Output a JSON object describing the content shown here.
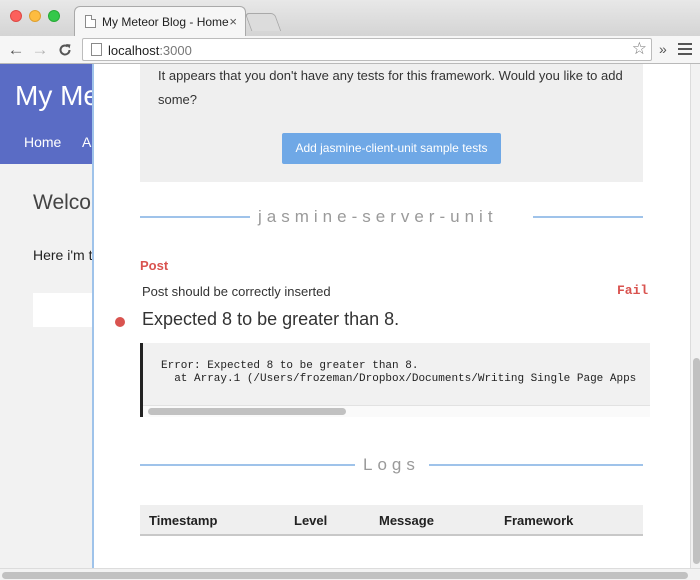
{
  "browser": {
    "tab_title": "My Meteor Blog - Home",
    "tab_close": "×",
    "url_host": "localhost",
    "url_port": ":3000",
    "back_glyph": "←",
    "forward_glyph": "→",
    "reload_glyph": "C",
    "star_glyph": "☆",
    "overflow_glyph": "»"
  },
  "blog": {
    "title": "My Me",
    "nav_home": "Home",
    "nav_a": "A",
    "welcome": "Welco",
    "text": "Here i'm t"
  },
  "velocity": {
    "notice_text": "It appears that you don't have any tests for this framework. Would you like to add some?",
    "add_button_label": "Add jasmine-client-unit sample tests",
    "server_section_label": "jasmine-server-unit",
    "suite_name": "Post",
    "test_name": "Post should be correctly inserted",
    "status_label": "Fail",
    "failure_message": "Expected 8 to be greater than 8.",
    "stack_line_1": "Error: Expected 8 to be greater than 8.",
    "stack_line_2": "  at Array.1 (/Users/frozeman/Dropbox/Documents/Writing Single Page Apps",
    "logs_section_label": "Logs",
    "logs_columns": [
      "Timestamp",
      "Level",
      "Message",
      "Framework"
    ]
  },
  "colors": {
    "header_blue": "#5a6cc5",
    "accent_blue": "#9fc3ea",
    "button_blue": "#6fa8e6",
    "fail_red": "#d9534f"
  },
  "icons": [
    "close-dot",
    "minimize-dot",
    "maximize-dot",
    "page-icon",
    "back-arrow-icon",
    "forward-arrow-icon",
    "reload-icon",
    "star-icon",
    "menu-icon",
    "fail-dot-icon"
  ]
}
